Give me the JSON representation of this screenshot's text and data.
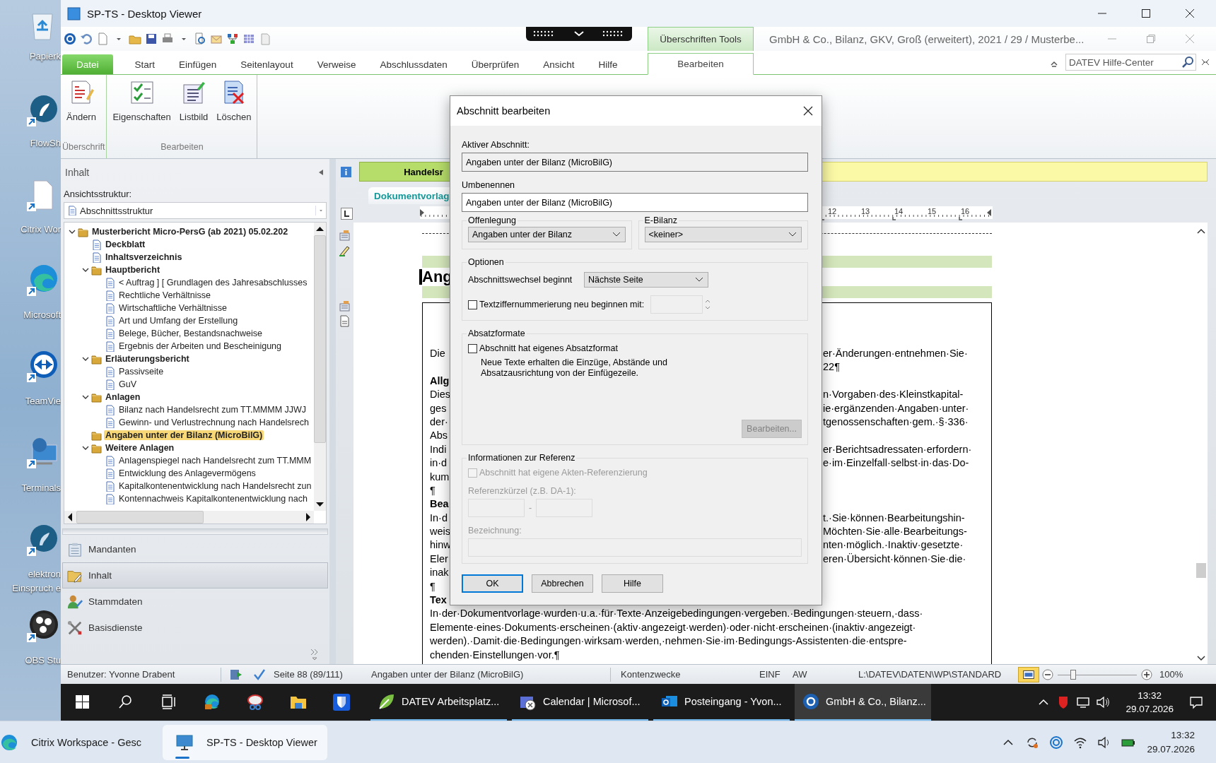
{
  "window": {
    "title": "SP-TS - Desktop Viewer"
  },
  "desktop_icons": [
    {
      "labels": [
        "Papierk"
      ]
    },
    {
      "labels": [
        "FlowSh"
      ]
    },
    {
      "labels": [
        "Citrix Wor"
      ]
    },
    {
      "labels": [
        "Microsoft"
      ]
    },
    {
      "labels": [
        "TeamVie"
      ]
    },
    {
      "labels": [
        "Terminals"
      ]
    },
    {
      "labels": [
        "elektron",
        "Einspruch e"
      ]
    },
    {
      "labels": [
        "OBS Stu"
      ]
    }
  ],
  "ribbon": {
    "contextual_header": "Überschriften Tools",
    "document_title": "GmbH & Co., Bilanz, GKV, Groß (erweitert), 2021 / 29 / Musterbe...",
    "tabs": [
      {
        "label": "Datei",
        "kind": "file",
        "selected": false
      },
      {
        "label": "Start",
        "kind": "tab",
        "selected": false
      },
      {
        "label": "Einfügen",
        "kind": "tab",
        "selected": false
      },
      {
        "label": "Seitenlayout",
        "kind": "tab",
        "selected": false
      },
      {
        "label": "Verweise",
        "kind": "tab",
        "selected": false
      },
      {
        "label": "Abschlussdaten",
        "kind": "tab",
        "selected": false
      },
      {
        "label": "Überprüfen",
        "kind": "tab",
        "selected": false
      },
      {
        "label": "Ansicht",
        "kind": "tab",
        "selected": false
      },
      {
        "label": "Hilfe",
        "kind": "tab",
        "selected": false
      },
      {
        "label": "Bearbeiten",
        "kind": "contextual",
        "selected": true
      }
    ],
    "help_search": {
      "placeholder": "DATEV Hilfe-Center"
    },
    "groups": [
      {
        "label": "Überschrift",
        "buttons": [
          "Ändern"
        ]
      },
      {
        "label": "Bearbeiten",
        "buttons": [
          "Eigenschaften",
          "Listbild",
          "Löschen"
        ]
      }
    ]
  },
  "navigation": {
    "header": "Inhalt",
    "view_label": "Ansichtsstruktur:",
    "view_select": "Abschnittsstruktur",
    "tree": [
      {
        "label": "Musterbericht Micro-PersG (ab 2021) 05.02.202",
        "kind": "folder",
        "expanded": true,
        "selected": false,
        "children": [
          {
            "label": "Deckblatt",
            "kind": "document",
            "selected": false
          },
          {
            "label": "Inhaltsverzeichnis",
            "kind": "document",
            "selected": false
          },
          {
            "label": "Hauptbericht",
            "kind": "folder",
            "expanded": true,
            "selected": false,
            "children": [
              {
                "label": "< Auftrag ] [ Grundlagen des Jahresabschlusses",
                "kind": "document",
                "selected": false
              },
              {
                "label": "Rechtliche Verhältnisse",
                "kind": "document",
                "selected": false
              },
              {
                "label": "Wirtschaftliche Verhältnisse",
                "kind": "document",
                "selected": false
              },
              {
                "label": "Art und Umfang der Erstellung",
                "kind": "document",
                "selected": false
              },
              {
                "label": "Belege, Bücher, Bestandsnachweise",
                "kind": "document",
                "selected": false
              },
              {
                "label": "Ergebnis der Arbeiten und Bescheinigung",
                "kind": "document",
                "selected": false
              }
            ]
          },
          {
            "label": "Erläuterungsbericht",
            "kind": "folder",
            "expanded": true,
            "selected": false,
            "children": [
              {
                "label": "Passivseite",
                "kind": "document",
                "selected": false
              },
              {
                "label": "GuV",
                "kind": "document",
                "selected": false
              }
            ]
          },
          {
            "label": "Anlagen",
            "kind": "folder",
            "expanded": true,
            "selected": false,
            "children": [
              {
                "label": "Bilanz nach Handelsrecht zum TT.MMMM JJWJ",
                "kind": "document",
                "selected": false
              },
              {
                "label": "Gewinn- und Verlustrechnung nach Handelsrech",
                "kind": "document",
                "selected": false
              }
            ]
          },
          {
            "label": "Angaben unter der Bilanz (MicroBilG)",
            "kind": "folder",
            "selected": true
          },
          {
            "label": "Weitere Anlagen",
            "kind": "folder",
            "expanded": true,
            "selected": false,
            "children": [
              {
                "label": "Anlagenspiegel nach Handelsrecht zum TT.MMM",
                "kind": "document",
                "selected": false
              },
              {
                "label": "Entwicklung des Anlagevermögens",
                "kind": "document",
                "selected": false
              },
              {
                "label": "Kapitalkontenentwicklung nach Handelsrecht zun",
                "kind": "document",
                "selected": false
              },
              {
                "label": "Kontennachweis Kapitalkontenentwicklung nach",
                "kind": "document",
                "selected": false
              }
            ]
          }
        ]
      }
    ],
    "sections": [
      {
        "label": "Mandanten",
        "selected": false
      },
      {
        "label": "Inhalt",
        "selected": true
      },
      {
        "label": "Stammdaten",
        "selected": false
      },
      {
        "label": "Basisdienste",
        "selected": false
      }
    ]
  },
  "document": {
    "info_tab": "Handelsr",
    "template_tab": "Dokumentvorlag",
    "ruler_numbers": [
      "12",
      "13",
      "14",
      "15",
      "16"
    ],
    "heading": "Ang",
    "lines": [
      {
        "kind": "text",
        "left": "Die",
        "right": "er·Änderungen·entnehmen·Sie·"
      },
      {
        "kind": "text",
        "right": "22¶"
      },
      {
        "kind": "heading",
        "left": "Allg"
      },
      {
        "kind": "text",
        "left": "Dies",
        "right": "n·Vorgaben·des·Kleinstkapital-"
      },
      {
        "kind": "text",
        "left": "ges",
        "right": "ie·ergänzenden·Angaben·unter·"
      },
      {
        "kind": "text",
        "left": "der·",
        "right": "tgenossenschaften·gem.·§·336·"
      },
      {
        "kind": "text",
        "left": "Abs"
      },
      {
        "kind": "text",
        "left": "Indi",
        "right": "er·Berichtsadressaten·erfordern·"
      },
      {
        "kind": "text",
        "left": "in·d",
        "right": "e·im·Einzelfall·selbst·in·das·Do-"
      },
      {
        "kind": "text",
        "left": "kum"
      },
      {
        "kind": "text",
        "left": "¶"
      },
      {
        "kind": "heading",
        "left": "Bea"
      },
      {
        "kind": "text",
        "left": "In·d",
        "right": "t.·Sie·können·Bearbeitungshin-"
      },
      {
        "kind": "text",
        "left": "weis",
        "right": "Möchten·Sie·alle·Bearbeitungs-"
      },
      {
        "kind": "text",
        "left": "hinw",
        "right": "nten·möglich.·Inaktiv·gesetzte·"
      },
      {
        "kind": "text",
        "left": "Eler",
        "right": "eren·Übersicht·können·Sie·die·"
      },
      {
        "kind": "text",
        "left": "inak"
      },
      {
        "kind": "text",
        "left": "¶"
      },
      {
        "kind": "heading",
        "left": "Tex"
      }
    ],
    "full_lines": [
      "In·der·Dokumentvorlage·wurden·u.a.·für·Texte·Anzeigebedingungen·vergeben.·Bedingungen·steuern,·dass·",
      "Elemente·eines·Dokuments·erscheinen·(aktiv·angezeigt·werden)·oder·nicht·erscheinen·(inaktiv·angezeigt·",
      "werden).·Damit·die·Bedingungen·wirksam·werden,·nehmen·Sie·im·Bedingungs-Assistenten·die·entspre-",
      "chenden·Einstellungen·vor.¶"
    ]
  },
  "dialog": {
    "title": "Abschnitt bearbeiten",
    "active_section": {
      "label": "Aktiver Abschnitt:",
      "value": "Angaben unter der Bilanz (MicroBilG)"
    },
    "rename": {
      "label": "Umbenennen",
      "value": "Angaben unter der Bilanz (MicroBilG)"
    },
    "disclosure": {
      "label": "Offenlegung",
      "value": "Angaben unter der Bilanz"
    },
    "e_balance": {
      "label": "E-Bilanz",
      "value": "<keiner>"
    },
    "options": {
      "label": "Optionen",
      "break_label": "Abschnittswechsel beginnt",
      "break_value": "Nächste Seite",
      "renumber": {
        "label": "Textziffernummerierung neu beginnen mit:",
        "checked": false
      }
    },
    "paragraph_formats": {
      "label": "Absatzformate",
      "own_format": {
        "label": "Abschnitt hat eigenes Absatzformat",
        "checked": false
      },
      "hint": "Neue Texte erhalten die Einzüge, Abstände und Absatzausrichtung von der Einfügezeile.",
      "button": {
        "label": "Bearbeiten...",
        "disabled": true
      }
    },
    "reference": {
      "label": "Informationen zur Referenz",
      "own_reference": {
        "label": "Abschnitt hat eigene Akten-Referenzierung",
        "checked": false,
        "disabled": true
      },
      "abbreviation_label": "Referenzkürzel (z.B. DA-1):",
      "separator": "-",
      "name_label": "Bezeichnung:"
    },
    "buttons": [
      {
        "label": "OK",
        "kind": "default"
      },
      {
        "label": "Abbrechen",
        "kind": "normal"
      },
      {
        "label": "Hilfe",
        "kind": "normal"
      }
    ]
  },
  "status_bar": {
    "user": "Benutzer: Yvonne Drabent",
    "page": "Seite 88 (89/111)",
    "section": "Angaben unter der Bilanz (MicroBilG)",
    "purpose": "Kontenzwecke",
    "insert_mode": "EINF",
    "aw": "AW",
    "path": "L:\\DATEV\\DATEN\\WP\\STANDARD",
    "zoom": {
      "level": 0.2,
      "reading": "100%"
    }
  },
  "session_taskbar": {
    "apps": [
      {
        "label": "DATEV Arbeitsplatz...",
        "selected": false
      },
      {
        "label": "Calendar | Microsof...",
        "selected": false
      },
      {
        "label": "Posteingang - Yvon...",
        "selected": false
      },
      {
        "label": "GmbH & Co., Bilanz...",
        "selected": true
      }
    ],
    "time": "13:32",
    "date": "29.07.2026"
  },
  "taskbar": {
    "apps": [
      {
        "label": "Citrix Workspace - Gesc",
        "selected": false
      },
      {
        "label": "SP-TS - Desktop Viewer",
        "selected": true
      }
    ],
    "time": "13:32",
    "date": "29.07.2026"
  }
}
